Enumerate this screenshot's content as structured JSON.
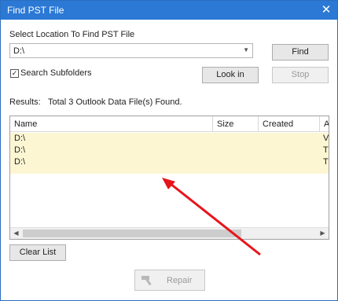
{
  "window": {
    "title": "Find PST File",
    "close_label": "✕"
  },
  "location": {
    "label": "Select Location To Find PST File",
    "value": "D:\\"
  },
  "buttons": {
    "find": "Find",
    "look_in": "Look in",
    "stop": "Stop",
    "clear_list": "Clear List",
    "repair": "Repair"
  },
  "options": {
    "search_subfolders_label": "Search Subfolders",
    "search_subfolders_checked": "✓"
  },
  "results": {
    "label": "Results:",
    "summary": "Total 3 Outlook Data File(s) Found."
  },
  "table": {
    "columns": [
      "Name",
      "Size",
      "Created",
      "A"
    ],
    "rows": [
      {
        "name": "D:\\",
        "extra": "V"
      },
      {
        "name": "D:\\",
        "extra": "T"
      },
      {
        "name": "D:\\",
        "extra": "T"
      }
    ]
  },
  "scrollbar": {
    "left_arrow": "◀",
    "right_arrow": "▶"
  },
  "annotation": {
    "arrow_color": "#e8141c"
  }
}
